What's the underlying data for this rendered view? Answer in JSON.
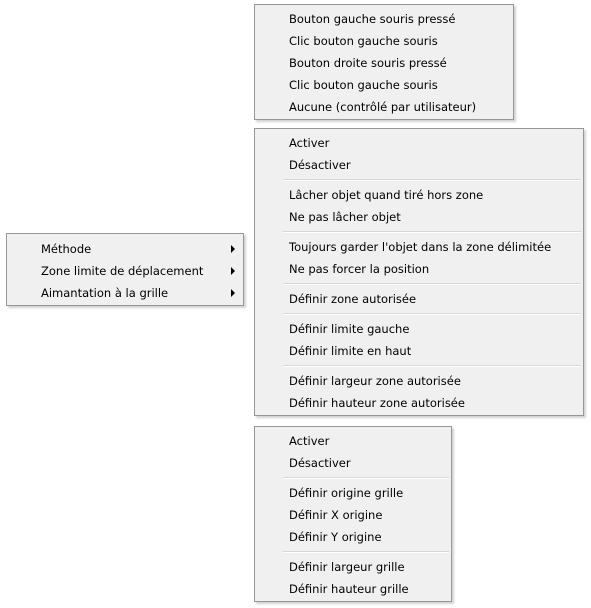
{
  "main_menu": {
    "items": [
      {
        "label": "Méthode"
      },
      {
        "label": "Zone limite de déplacement"
      },
      {
        "label": "Aimantation à la grille"
      }
    ]
  },
  "method_menu": {
    "items": [
      {
        "label": "Bouton gauche souris pressé"
      },
      {
        "label": "Clic bouton gauche souris"
      },
      {
        "label": "Bouton droite souris pressé"
      },
      {
        "label": "Clic bouton gauche souris"
      },
      {
        "label": "Aucune (contrôlé par utilisateur)"
      }
    ]
  },
  "zone_menu": {
    "items": [
      {
        "label": "Activer"
      },
      {
        "label": "Désactiver"
      },
      {
        "label": "Lâcher objet quand tiré hors zone"
      },
      {
        "label": "Ne pas lâcher objet"
      },
      {
        "label": "Toujours garder l'objet dans la zone délimitée"
      },
      {
        "label": "Ne pas forcer la position"
      },
      {
        "label": "Définir zone autorisée"
      },
      {
        "label": "Définir limite gauche"
      },
      {
        "label": "Définir limite en haut"
      },
      {
        "label": "Définir largeur zone autorisée"
      },
      {
        "label": "Définir hauteur zone autorisée"
      }
    ]
  },
  "grid_menu": {
    "items": [
      {
        "label": "Activer"
      },
      {
        "label": "Désactiver"
      },
      {
        "label": "Définir origine grille"
      },
      {
        "label": "Définir X origine"
      },
      {
        "label": "Définir Y origine"
      },
      {
        "label": "Définir largeur grille"
      },
      {
        "label": "Définir hauteur grille"
      }
    ]
  },
  "colors": {
    "menu_background": "#f0f0f0",
    "menu_border": "#979797",
    "separator": "#d7d7d7"
  },
  "icons": {
    "submenu_arrow": "chevron-right-icon"
  }
}
